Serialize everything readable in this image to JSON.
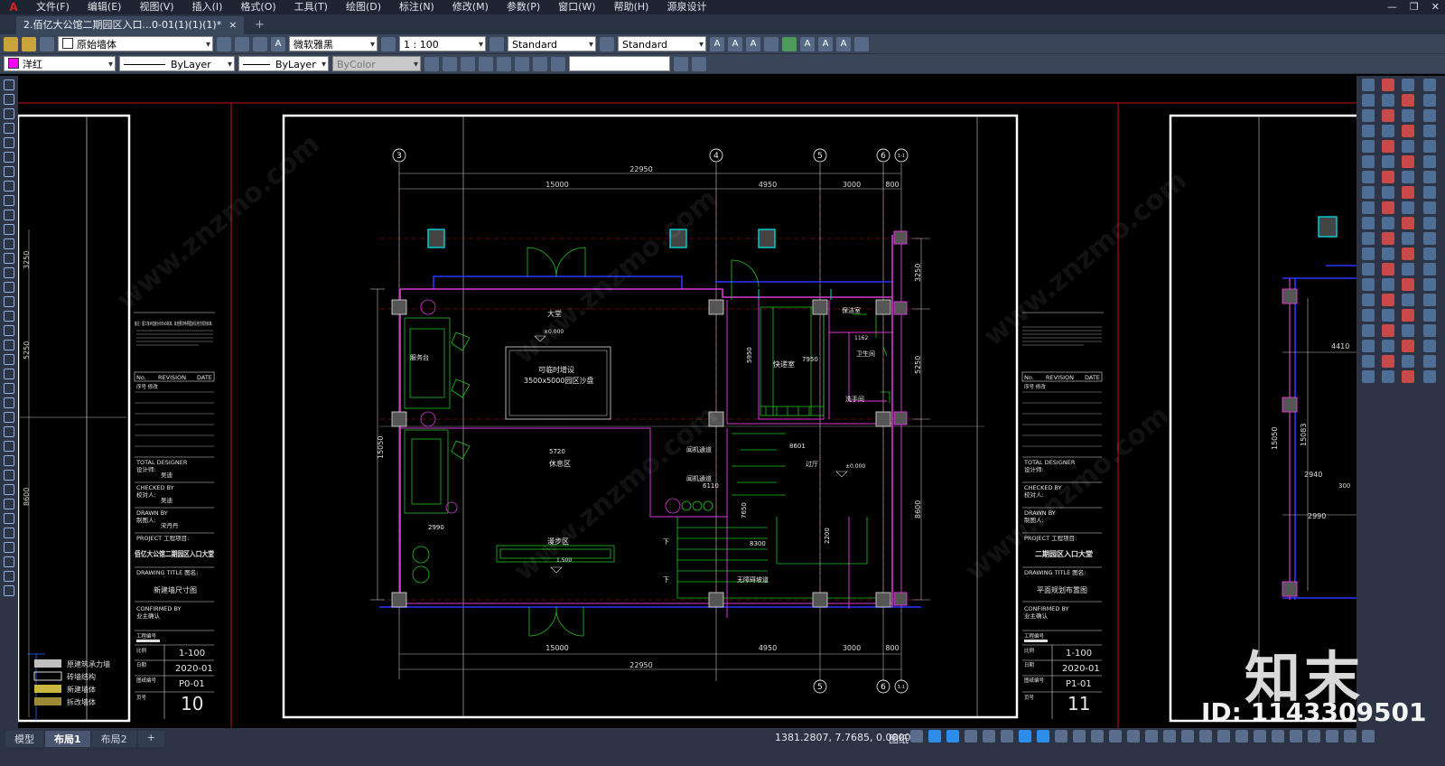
{
  "menu": {
    "items": [
      "文件(F)",
      "编辑(E)",
      "视图(V)",
      "插入(I)",
      "格式(O)",
      "工具(T)",
      "绘图(D)",
      "标注(N)",
      "修改(M)",
      "参数(P)",
      "窗口(W)",
      "帮助(H)",
      "源泉设计"
    ]
  },
  "doc_tab": {
    "title": "2.佰亿大公馆二期园区入口...0-01(1)(1)(1)*",
    "close": "×",
    "add": "+"
  },
  "toolbar1": {
    "layer": "原始墙体",
    "text_style": "微软雅黑",
    "scale": "1 : 100",
    "dim_style": "Standard",
    "mleader_style": "Standard"
  },
  "toolbar2": {
    "color": "洋红",
    "linetype": "ByLayer",
    "lineweight": "ByLayer",
    "plotstyle": "ByColor"
  },
  "drawing": {
    "grid_labels": {
      "g3": "3",
      "g4": "4",
      "g5": "5",
      "g6": "6",
      "g61": "1-1"
    },
    "dims_top": {
      "total": "22950",
      "d1": "15000",
      "d2": "4950",
      "d3": "3000",
      "d4": "800"
    },
    "dims_bottom": {
      "total": "22950",
      "d1": "15000",
      "d2": "4950",
      "d3": "3000",
      "d4": "800"
    },
    "dims_right": {
      "d1": "3250",
      "d2": "5250",
      "d3": "8600"
    },
    "dims_left": {
      "total": "15050"
    },
    "rooms": {
      "hall": "大堂",
      "hall_level": "±0.000",
      "sandtable1": "可临时增设",
      "sandtable2": "3500x5000园区沙盘",
      "service": "服务台",
      "rest": "休息区",
      "walk": "漫步区",
      "walk_level": "1.500",
      "express": "快递室",
      "storage": "保洁室",
      "toilet": "卫生间",
      "washroom": "洗手间",
      "lobby": "过厅",
      "lobby_level": "±0.000",
      "corridor1": "闻机通道",
      "corridor2": "闻机通道",
      "ramp": "无障碍坡道",
      "down1": "下",
      "down2": "下"
    },
    "inner_dims": {
      "d5720": "5720",
      "d6110": "6110",
      "d8601": "8601",
      "d7950": "7950",
      "d5950": "5950",
      "d2990": "2990",
      "d7650": "7650",
      "d8300": "8300",
      "d2200": "2200",
      "d1162": "1162"
    },
    "sheet_left": {
      "note": "备注：图工技术措施为5年A3标准。其他要求参照国家及地方规范标准。",
      "rev_no": "No.",
      "rev": "REVISION",
      "date": "DATE",
      "rev_row": "序号    修改",
      "designer": "TOTAL DESIGNER",
      "designer_cn": "设计师:",
      "designer_name": "吴迪",
      "checked": "CHECKED BY",
      "checked_cn": "校对人:",
      "checked_name": "吴迪",
      "drawn": "DRAWN BY",
      "drawn_cn": "制图人:",
      "drawn_name": "宋丹丹",
      "project": "PROJECT 工程项目:",
      "project_name": "佰亿大公馆二期园区入口大堂",
      "title": "DRAWING TITLE 图名:",
      "title_name": "新建墙尺寸图",
      "confirmed": "CONFIRMED BY",
      "confirmed_cn": "业主确认",
      "project_no": "工程编号",
      "scale_lbl": "比例",
      "scale": "1-100",
      "date_lbl": "日期",
      "date_val": "2020-01",
      "no_lbl": "图纸编号",
      "no_val": "P0-01",
      "page_lbl": "页号",
      "page": "10"
    },
    "sheet_right": {
      "designer": "TOTAL DESIGNER",
      "designer_cn": "设计师:",
      "checked": "CHECKED BY",
      "checked_cn": "校对人:",
      "drawn": "DRAWN BY",
      "drawn_cn": "制图人:",
      "project": "PROJECT 工程项目:",
      "project_name": "二期园区入口大堂",
      "title": "DRAWING TITLE 图名:",
      "title_name": "平面规划布置图",
      "confirmed": "CONFIRMED BY",
      "confirmed_cn": "业主确认",
      "project_no": "工程编号",
      "scale_lbl": "比例",
      "scale": "1-100",
      "date_lbl": "日期",
      "date_val": "2020-01",
      "no_lbl": "图纸编号",
      "no_val": "P1-01",
      "page_lbl": "页号",
      "page": "11",
      "rev_no": "No.",
      "rev": "REVISION",
      "date": "DATE",
      "rev_row": "序号    修改"
    },
    "legend": {
      "l1": "原建筑承力墙",
      "l2": "砖墙结构",
      "l3": "新建墙体",
      "l4": "拆改墙体"
    },
    "left_dims": {
      "d3250": "3250",
      "d5250": "5250",
      "d8600": "8600"
    },
    "right_part": {
      "d4410": "4410",
      "d15050": "15050",
      "d15083": "15083",
      "d2940": "2940",
      "d300": "300",
      "d2990": "2990"
    },
    "watermark": "www.znzmo.com"
  },
  "layout_tabs": {
    "model": "模型",
    "l1": "布局1",
    "l2": "布局2",
    "add": "+"
  },
  "status": {
    "coords": "1381.2807, 7.7685, 0.0000",
    "paper": "图纸"
  },
  "brand": {
    "logo": "知末",
    "id": "ID: 1143309501"
  }
}
